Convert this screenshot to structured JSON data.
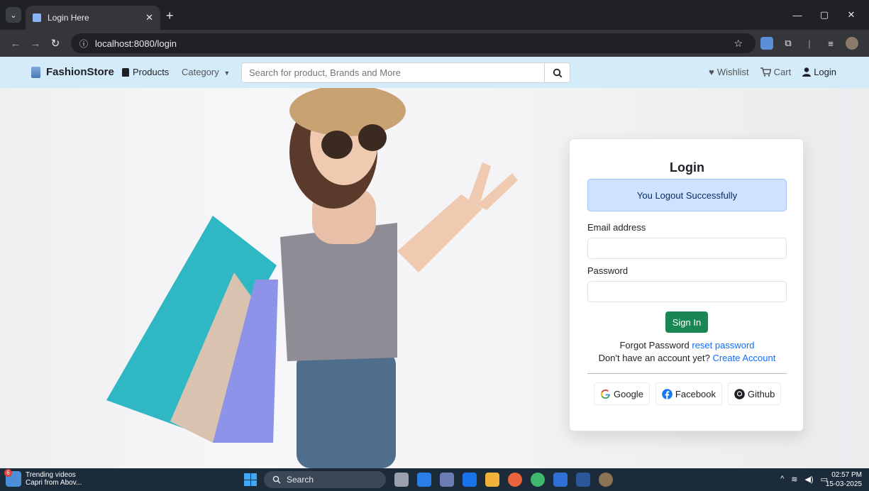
{
  "browser": {
    "tab_title": "Login Here",
    "url": "localhost:8080/login"
  },
  "navbar": {
    "brand": "FashionStore",
    "products": "Products",
    "category": "Category",
    "search_placeholder": "Search for product, Brands and More",
    "wishlist": "Wishlist",
    "cart": "Cart",
    "login": "Login"
  },
  "login": {
    "title": "Login",
    "alert": "You Logout Successfully",
    "email_label": "Email address",
    "password_label": "Password",
    "signin": "Sign In",
    "forgot_text": "Forgot Password",
    "reset_link": "reset password",
    "no_account_text": "Don't have an account yet?",
    "create_link": "Create Account",
    "social": {
      "google": "Google",
      "facebook": "Facebook",
      "github": "Github"
    }
  },
  "taskbar": {
    "news_title": "Trending videos",
    "news_sub": "Capri from Abov...",
    "news_badge": "6",
    "search": "Search",
    "time": "02:57 PM",
    "date": "15-03-2025"
  },
  "colors": {
    "navbar_bg": "#d4ecfa",
    "signin_green": "#198754",
    "alert_bg": "#cfe2ff",
    "link": "#0d6efd"
  }
}
